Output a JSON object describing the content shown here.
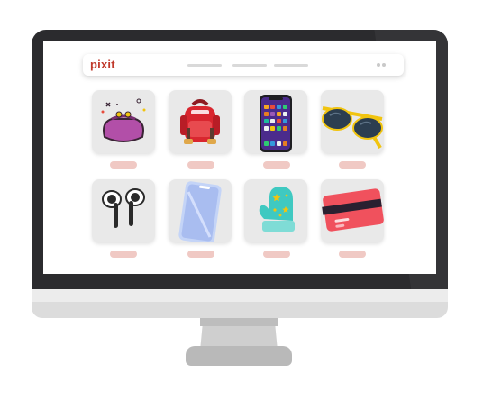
{
  "app": {
    "logo_text": "pixit"
  },
  "nav": {
    "links_count_note": ""
  },
  "products": [
    {
      "icon": "coin-purse-icon"
    },
    {
      "icon": "backpack-icon"
    },
    {
      "icon": "smartphone-icon"
    },
    {
      "icon": "sunglasses-icon"
    },
    {
      "icon": "earbuds-icon"
    },
    {
      "icon": "screen-protector-icon"
    },
    {
      "icon": "mitten-icon"
    },
    {
      "icon": "credit-card-icon"
    }
  ],
  "colors": {
    "accent": "#c0392b",
    "monitor_bezel": "#2b2b2e",
    "card_bg": "#e9e9e9",
    "price_pill": "#f0c9c4"
  }
}
